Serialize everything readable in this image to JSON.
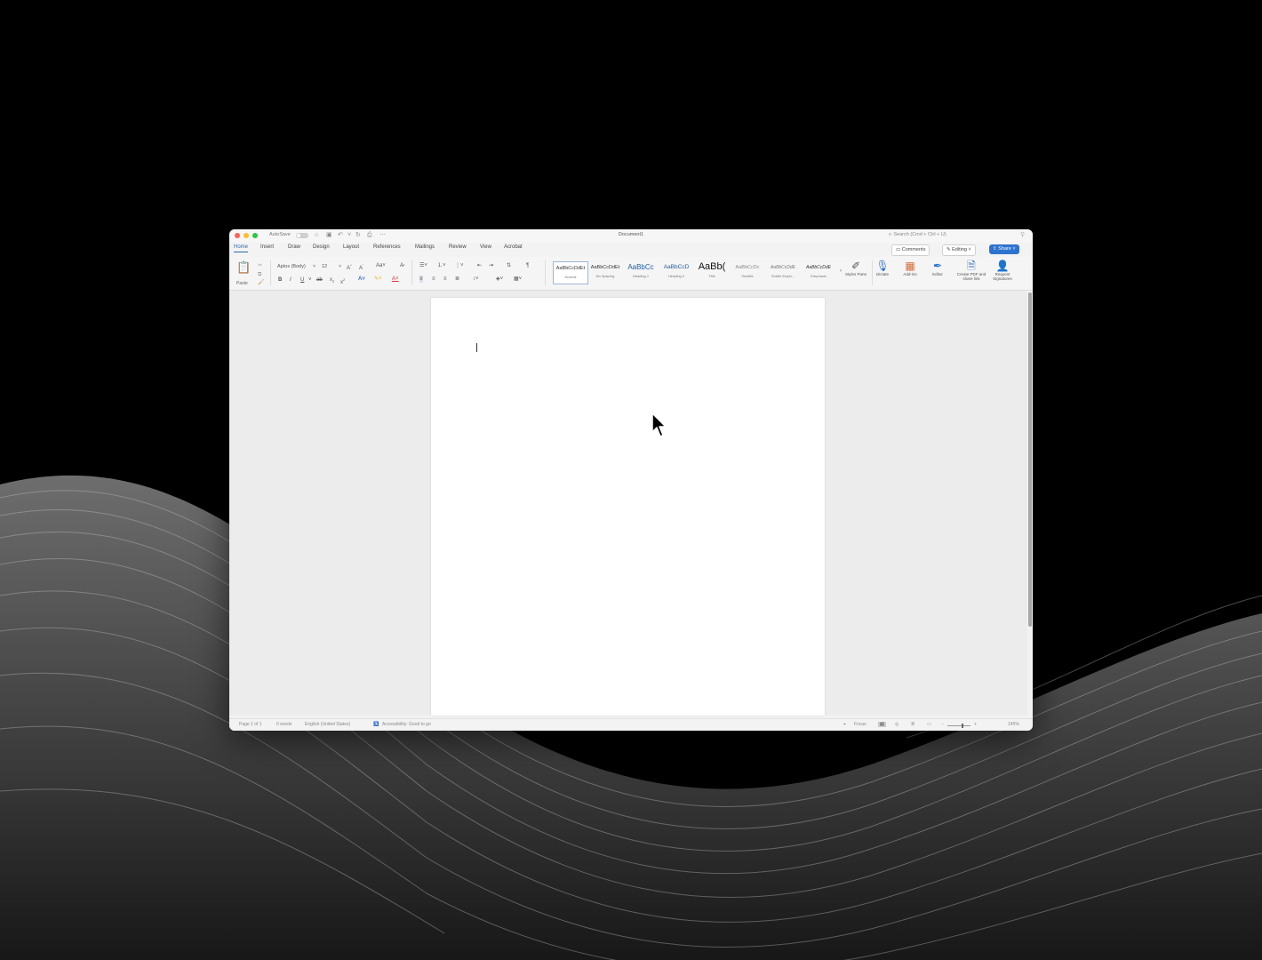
{
  "window": {
    "title": "Document1",
    "autosave_label": "AutoSave",
    "search_placeholder": "Search (Cmd + Ctrl + U)"
  },
  "tabs": [
    "Home",
    "Insert",
    "Draw",
    "Design",
    "Layout",
    "References",
    "Mailings",
    "Review",
    "View",
    "Acrobat"
  ],
  "active_tab": "Home",
  "header_buttons": {
    "comments": "Comments",
    "editing": "Editing",
    "share": "Share"
  },
  "ribbon": {
    "paste": "Paste",
    "font_name": "Aptos (Body)",
    "font_size": "12",
    "styles": [
      {
        "sample": "AaBbCcDdEt",
        "name": "Normal"
      },
      {
        "sample": "AaBbCcDdEt",
        "name": "No Spacing"
      },
      {
        "sample": "AaBbCc",
        "name": "Heading 1"
      },
      {
        "sample": "AaBbCcD",
        "name": "Heading 2"
      },
      {
        "sample": "AaBb(",
        "name": "Title"
      },
      {
        "sample": "AaBbCcDc",
        "name": "Subtitle"
      },
      {
        "sample": "AaBbCcDdE",
        "name": "Subtle Emph..."
      },
      {
        "sample": "AaBbCcDdE",
        "name": "Emphasis"
      }
    ],
    "styles_pane": "Styles Pane",
    "dictate": "Dictate",
    "add_ins": "Add-ins",
    "editor": "Editor",
    "create_pdf": "Create PDF and share link",
    "request_signatures": "Request Signatures"
  },
  "status_bar": {
    "page": "Page 1 of 1",
    "words": "0 words",
    "language": "English (United States)",
    "accessibility": "Accessibility: Good to go",
    "focus": "Focus",
    "zoom": "145%"
  }
}
